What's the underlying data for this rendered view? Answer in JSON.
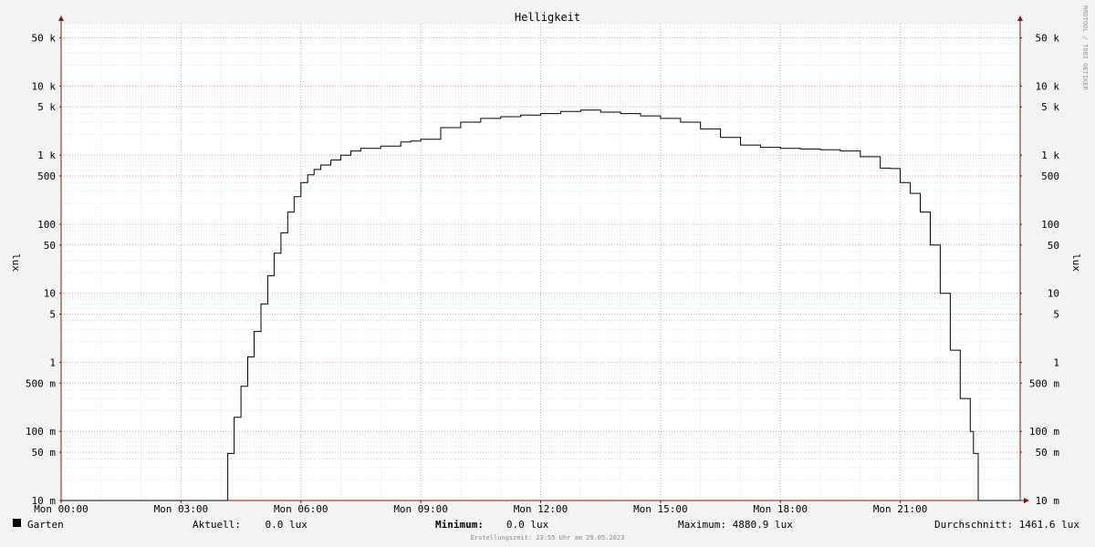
{
  "chart_data": {
    "type": "line",
    "title": "Helligkeit",
    "ylabel": "lux",
    "scale": "log",
    "ylim": [
      0.01,
      80000
    ],
    "xlim_hours": [
      0,
      24
    ],
    "x_ticks": [
      {
        "hour": 0,
        "label": "Mon 00:00"
      },
      {
        "hour": 3,
        "label": "Mon 03:00"
      },
      {
        "hour": 6,
        "label": "Mon 06:00"
      },
      {
        "hour": 9,
        "label": "Mon 09:00"
      },
      {
        "hour": 12,
        "label": "Mon 12:00"
      },
      {
        "hour": 15,
        "label": "Mon 15:00"
      },
      {
        "hour": 18,
        "label": "Mon 18:00"
      },
      {
        "hour": 21,
        "label": "Mon 21:00"
      }
    ],
    "y_ticks": [
      {
        "value": 0.01,
        "label": "10 m"
      },
      {
        "value": 0.05,
        "label": "50 m"
      },
      {
        "value": 0.1,
        "label": "100 m"
      },
      {
        "value": 0.5,
        "label": "500 m"
      },
      {
        "value": 1,
        "label": "1"
      },
      {
        "value": 5,
        "label": "5"
      },
      {
        "value": 10,
        "label": "10"
      },
      {
        "value": 50,
        "label": "50"
      },
      {
        "value": 100,
        "label": "100"
      },
      {
        "value": 500,
        "label": "500"
      },
      {
        "value": 1000,
        "label": "1 k"
      },
      {
        "value": 5000,
        "label": "5 k"
      },
      {
        "value": 10000,
        "label": "10 k"
      },
      {
        "value": 50000,
        "label": "50 k"
      }
    ],
    "grid": true,
    "series": [
      {
        "name": "Garten",
        "color": "#000000",
        "points": [
          [
            0,
            0.01
          ],
          [
            4.15,
            0.01
          ],
          [
            4.17,
            0.048
          ],
          [
            4.33,
            0.16
          ],
          [
            4.5,
            0.45
          ],
          [
            4.67,
            1.2
          ],
          [
            4.83,
            2.8
          ],
          [
            5.0,
            7
          ],
          [
            5.17,
            18
          ],
          [
            5.33,
            38
          ],
          [
            5.5,
            75
          ],
          [
            5.67,
            150
          ],
          [
            5.83,
            250
          ],
          [
            6.0,
            400
          ],
          [
            6.17,
            520
          ],
          [
            6.33,
            620
          ],
          [
            6.5,
            720
          ],
          [
            6.75,
            850
          ],
          [
            7.0,
            1000
          ],
          [
            7.25,
            1150
          ],
          [
            7.5,
            1250
          ],
          [
            8.0,
            1350
          ],
          [
            8.5,
            1550
          ],
          [
            8.75,
            1600
          ],
          [
            9.0,
            1700
          ],
          [
            9.5,
            2500
          ],
          [
            10.0,
            3000
          ],
          [
            10.5,
            3400
          ],
          [
            11.0,
            3600
          ],
          [
            11.5,
            3800
          ],
          [
            12.0,
            4000
          ],
          [
            12.5,
            4300
          ],
          [
            13.0,
            4500
          ],
          [
            13.5,
            4200
          ],
          [
            14.0,
            4000
          ],
          [
            14.5,
            3700
          ],
          [
            15.0,
            3400
          ],
          [
            15.5,
            3000
          ],
          [
            16.0,
            2400
          ],
          [
            16.5,
            1800
          ],
          [
            17.0,
            1400
          ],
          [
            17.5,
            1300
          ],
          [
            18.0,
            1250
          ],
          [
            18.5,
            1230
          ],
          [
            19.0,
            1200
          ],
          [
            19.5,
            1150
          ],
          [
            20.0,
            950
          ],
          [
            20.5,
            650
          ],
          [
            20.75,
            640
          ],
          [
            21.0,
            400
          ],
          [
            21.25,
            280
          ],
          [
            21.5,
            150
          ],
          [
            21.75,
            50
          ],
          [
            22.0,
            10
          ],
          [
            22.25,
            1.5
          ],
          [
            22.5,
            0.3
          ],
          [
            22.75,
            0.1
          ],
          [
            22.83,
            0.048
          ],
          [
            22.93,
            0.048
          ],
          [
            22.95,
            0.01
          ],
          [
            24.0,
            0.01
          ]
        ]
      }
    ]
  },
  "legend": {
    "series_label": "Garten",
    "current": "Aktuell:    0.0 lux",
    "minimum_label": "Minimum:",
    "minimum_value": "   0.0 lux",
    "maximum": "Maximum: 4880.9 lux",
    "average": "Durchschnitt: 1461.6 lux"
  },
  "footer": "Erstellungszeit: 23:55 Uhr am 29.05.2023",
  "watermark": "RRDTOOL / TOBI OETIKER",
  "colors": {
    "background": "#f3f3f3",
    "canvas": "#ffffff",
    "grid_major": "#e8a0a0",
    "grid_minor": "#dddddd",
    "axis": "#7a1a1a",
    "line": "#000000"
  }
}
